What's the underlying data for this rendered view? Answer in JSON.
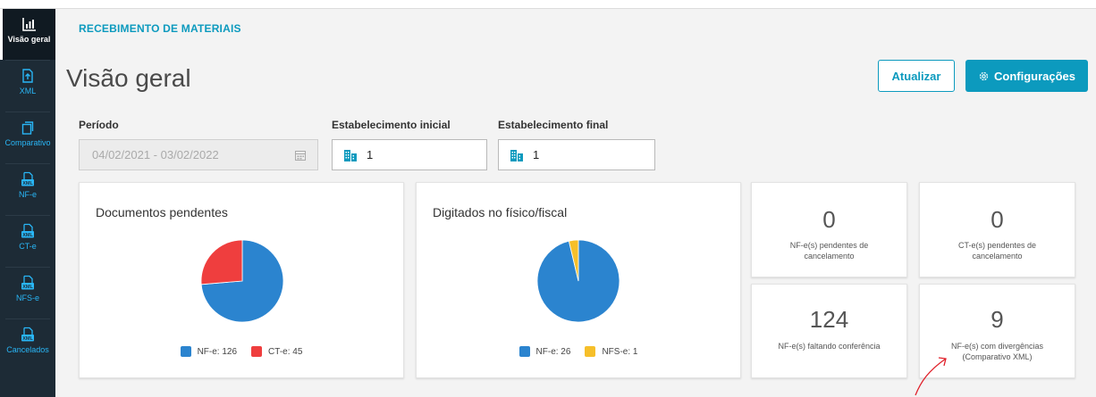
{
  "sidebar": {
    "items": [
      {
        "label": "Visão geral",
        "icon": "bar-chart-icon",
        "active": true
      },
      {
        "label": "XML",
        "icon": "upload-file-icon"
      },
      {
        "label": "Comparativo",
        "icon": "copy-icon"
      },
      {
        "label": "NF-e",
        "icon": "xml-file-icon"
      },
      {
        "label": "CT-e",
        "icon": "xml-file-icon"
      },
      {
        "label": "NFS-e",
        "icon": "xml-file-icon"
      },
      {
        "label": "Cancelados",
        "icon": "xml-file-icon"
      }
    ],
    "xml_badge": "XML"
  },
  "header": {
    "module": "RECEBIMENTO DE MATERIAIS",
    "title": "Visão geral",
    "refresh_label": "Atualizar",
    "config_label": "Configurações"
  },
  "filters": {
    "period_label": "Período",
    "period_value": "04/02/2021 - 03/02/2022",
    "estab_start_label": "Estabelecimento inicial",
    "estab_start_value": "1",
    "estab_end_label": "Estabelecimento final",
    "estab_end_value": "1"
  },
  "cards": {
    "pending_title": "Documentos pendentes",
    "typed_title": "Digitados no físico/fiscal",
    "stats": [
      {
        "value": "0",
        "label": "NF-e(s) pendentes de cancelamento"
      },
      {
        "value": "0",
        "label": "CT-e(s) pendentes de cancelamento"
      },
      {
        "value": "124",
        "label": "NF-e(s) faltando conferência"
      },
      {
        "value": "9",
        "label": "NF-e(s) com divergências (Comparativo XML)"
      }
    ]
  },
  "chart_data": [
    {
      "type": "pie",
      "title": "Documentos pendentes",
      "slices": [
        {
          "name": "NF-e",
          "value": 126,
          "legend": "NF-e: 126",
          "color": "#2b84cf"
        },
        {
          "name": "CT-e",
          "value": 45,
          "legend": "CT-e: 45",
          "color": "#ef3e3e"
        }
      ]
    },
    {
      "type": "pie",
      "title": "Digitados no físico/fiscal",
      "slices": [
        {
          "name": "NF-e",
          "value": 26,
          "legend": "NF-e: 26",
          "color": "#2b84cf"
        },
        {
          "name": "NFS-e",
          "value": 1,
          "legend": "NFS-e: 1",
          "color": "#f6bf2a"
        }
      ]
    }
  ],
  "colors": {
    "accent": "#0c9abe",
    "sidebar": "#1d2b36",
    "annotation": "#e0202a"
  }
}
